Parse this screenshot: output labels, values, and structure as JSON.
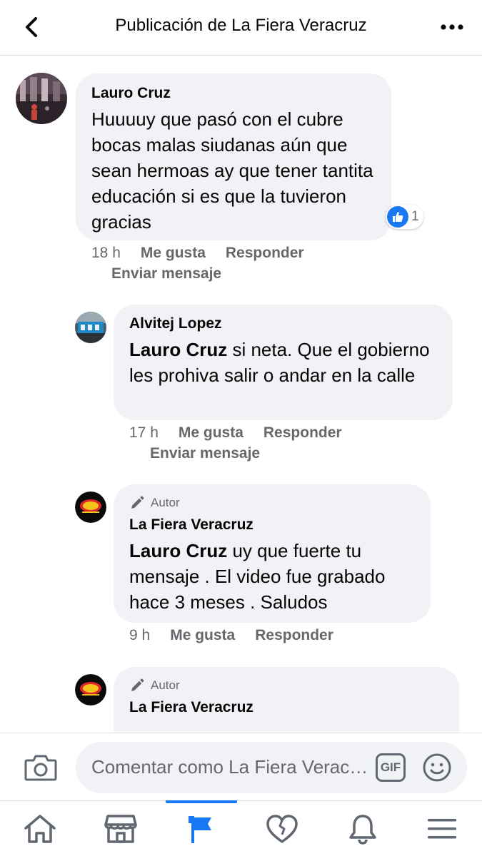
{
  "header": {
    "title": "Publicación de La Fiera Veracruz"
  },
  "comments": [
    {
      "author": "Lauro Cruz",
      "text": "Huuuuy que pasó con el cubre bocas malas siudanas aún que sean hermoas ay que tener tantita educación si es que la tuvieron gracias",
      "time": "18 h",
      "like_label": "Me gusta",
      "reply_label": "Responder",
      "send_message_label": "Enviar mensaje",
      "reaction_count": "1"
    },
    {
      "author": "Alvitej Lopez",
      "mention": "Lauro Cruz",
      "text": " si neta. Que el gobierno les prohiva salir o andar en la calle",
      "time": "17 h",
      "like_label": "Me gusta",
      "reply_label": "Responder",
      "send_message_label": "Enviar mensaje"
    },
    {
      "badge": "Autor",
      "author": "La Fiera Veracruz",
      "mention": "Lauro Cruz",
      "text": " uy que fuerte tu mensaje . El video fue grabado hace 3 meses . Saludos",
      "time": "9 h",
      "like_label": "Me gusta",
      "reply_label": "Responder"
    },
    {
      "badge": "Autor",
      "author": "La Fiera Veracruz"
    }
  ],
  "composer": {
    "placeholder": "Comentar como La Fiera Veracruz",
    "gif_label": "GIF"
  },
  "colors": {
    "bubble": "#f0f2f5",
    "secondary_text": "#65676b",
    "accent": "#1877f2"
  },
  "icons": {
    "back": "chevron-left-icon",
    "more": "more-horizontal-icon",
    "camera": "camera-icon",
    "gif": "gif-icon",
    "emoji": "smile-icon",
    "tabs": [
      "home-icon",
      "marketplace-icon",
      "pages-flag-icon",
      "dating-heart-icon",
      "notifications-bell-icon",
      "menu-icon"
    ]
  }
}
